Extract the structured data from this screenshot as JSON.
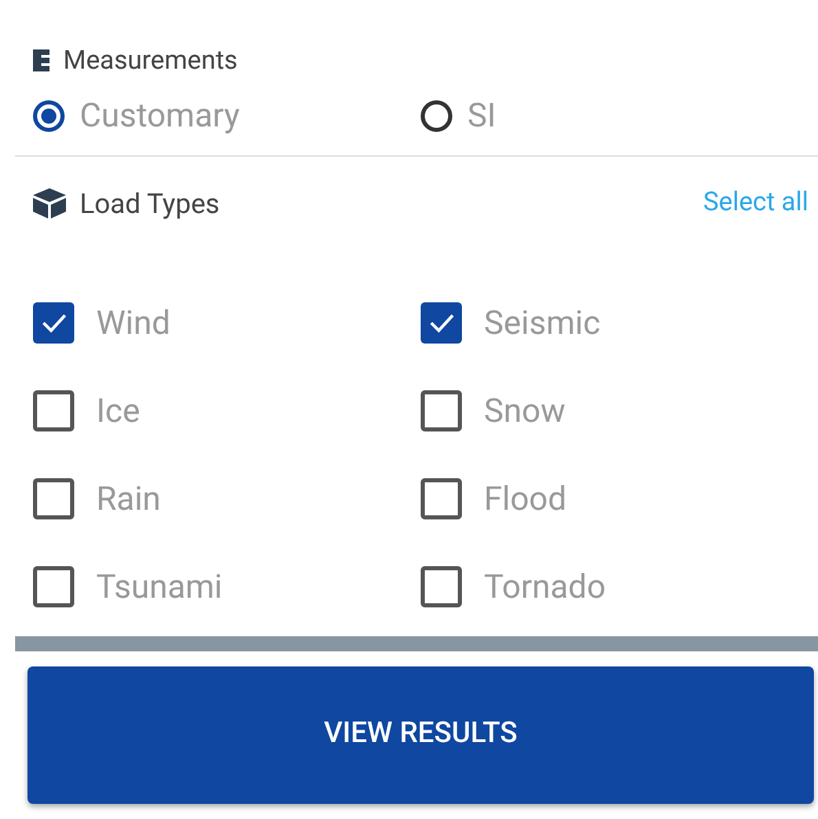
{
  "measurements": {
    "title": "Measurements",
    "options": [
      {
        "label": "Customary",
        "selected": true
      },
      {
        "label": "SI",
        "selected": false
      }
    ]
  },
  "load_types": {
    "title": "Load Types",
    "select_all": "Select all",
    "items": [
      {
        "label": "Wind",
        "checked": true
      },
      {
        "label": "Seismic",
        "checked": true
      },
      {
        "label": "Ice",
        "checked": false
      },
      {
        "label": "Snow",
        "checked": false
      },
      {
        "label": "Rain",
        "checked": false
      },
      {
        "label": "Flood",
        "checked": false
      },
      {
        "label": "Tsunami",
        "checked": false
      },
      {
        "label": "Tornado",
        "checked": false
      }
    ]
  },
  "button": "VIEW RESULTS"
}
